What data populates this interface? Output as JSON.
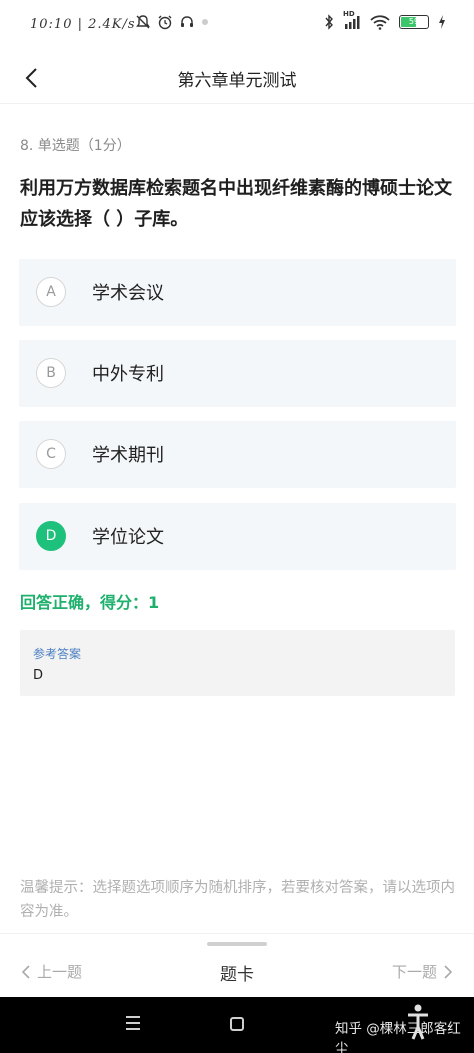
{
  "status_bar": {
    "time": "10:10",
    "net_speed": "2.4K/s",
    "battery_level": "59",
    "hd_label": "HD"
  },
  "nav": {
    "title": "第六章单元测试"
  },
  "question": {
    "meta": "8. 单选题（1分）",
    "text": "利用万方数据库检索题名中出现纤维素酶的博硕士论文应该选择（ ）子库。"
  },
  "options": [
    {
      "letter": "A",
      "label": "学术会议",
      "state": "default"
    },
    {
      "letter": "B",
      "label": "中外专利",
      "state": "default"
    },
    {
      "letter": "C",
      "label": "学术期刊",
      "state": "default"
    },
    {
      "letter": "D",
      "label": "学位论文",
      "state": "correct"
    }
  ],
  "result": {
    "text": "回答正确，得分：1"
  },
  "reference": {
    "title": "参考答案",
    "answer": "D"
  },
  "tip": {
    "text": "温馨提示：选择题选项顺序为随机排序，若要核对答案，请以选项内容为准。"
  },
  "bottom_bar": {
    "prev_label": "上一题",
    "card_label": "题卡",
    "next_label": "下一题"
  },
  "watermark": {
    "text": "知乎 @棵林三郎客红尘"
  },
  "colors": {
    "accent_green": "#1ec17c",
    "result_green": "#1eb06d",
    "option_bg": "#f4f7fa",
    "reference_title": "#4a7fc1"
  }
}
